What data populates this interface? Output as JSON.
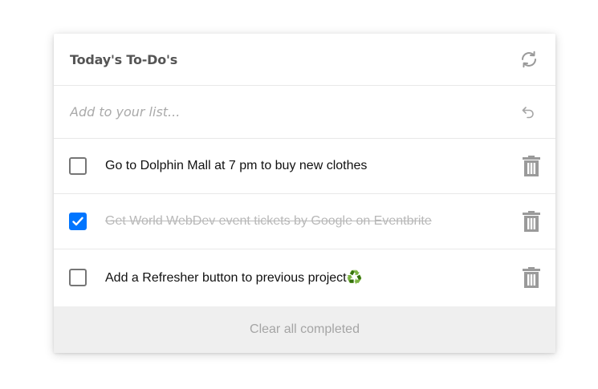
{
  "header": {
    "title": "Today's To-Do's",
    "refresh_icon": "refresh-icon"
  },
  "add": {
    "placeholder": "Add to your list...",
    "undo_icon": "undo-icon"
  },
  "todos": [
    {
      "text": "Go to Dolphin Mall at 7 pm to buy new clothes",
      "completed": false
    },
    {
      "text": "Get World WebDev event tickets by Google on Eventbrite",
      "completed": true
    },
    {
      "text": "Add a Refresher button to previous project♻️",
      "completed": false
    }
  ],
  "footer": {
    "clear_label": "Clear all completed"
  },
  "colors": {
    "accent": "#0075ff",
    "icon_gray": "#9a9a9a",
    "completed_text": "#b8b8b8",
    "footer_bg": "#efefef"
  }
}
